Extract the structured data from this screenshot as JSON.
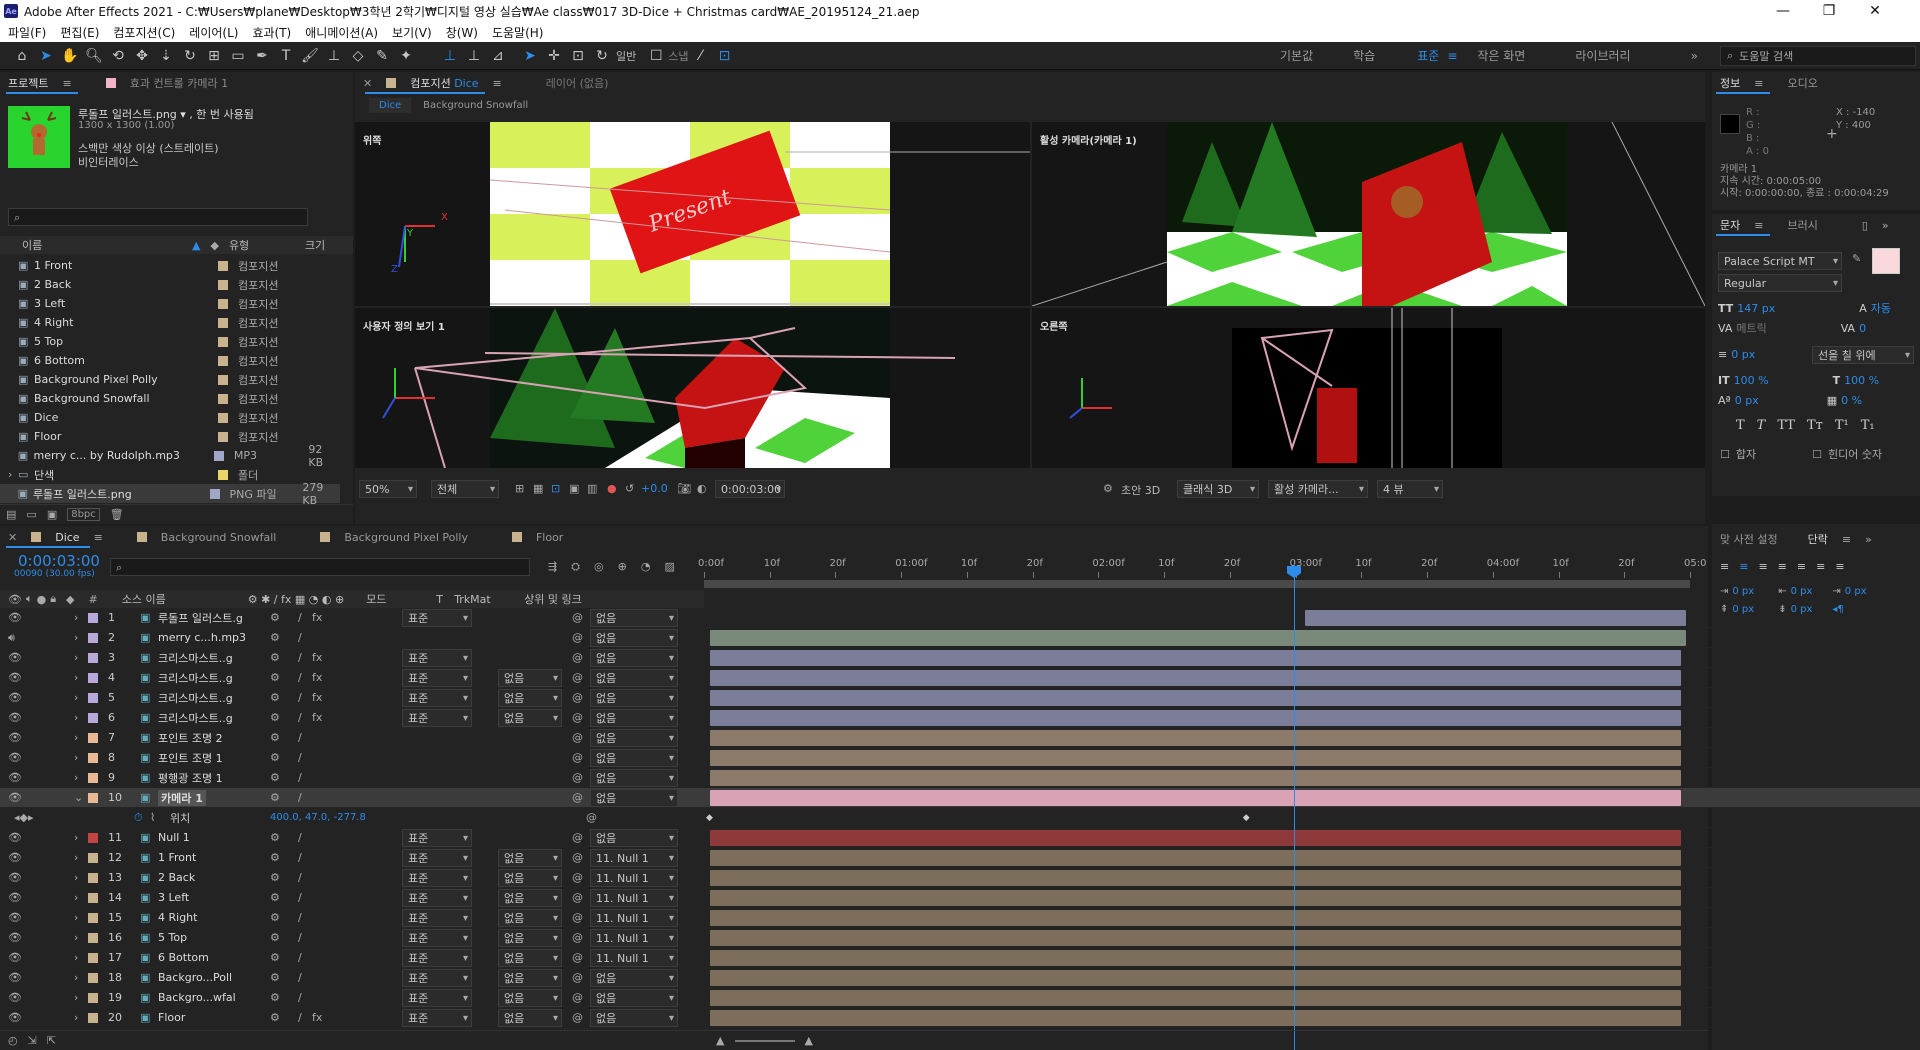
{
  "window": {
    "title": "Adobe After Effects 2021 - C:₩Users₩plane₩Desktop₩3학년 2학기₩디지털 영상 실습₩Ae class₩017 3D-Dice + Christmas card₩AE_20195124_21.aep",
    "minimize": "—",
    "maximize": "❐",
    "close": "✕"
  },
  "menu": [
    "파일(F)",
    "편집(E)",
    "컴포지션(C)",
    "레이어(L)",
    "효과(T)",
    "애니메이션(A)",
    "보기(V)",
    "창(W)",
    "도움말(H)"
  ],
  "toolbar": {
    "snap_label": "스냅",
    "orbit_label": "일반",
    "workspaces": [
      "기본값",
      "학습",
      "표준",
      "작은 화면",
      "라이브러리"
    ],
    "active_workspace": "표준",
    "help_search": "도움말 검색",
    "expand": "»"
  },
  "project": {
    "tab": "프로젝트",
    "effects_tab": "효과 컨트롤 카메라 1",
    "asset_name": "루돌프 일러스트.png ▾ , 한 번 사용됨",
    "asset_size": "1300 x 1300 (1.00)",
    "asset_alpha": "스백만 색상 이상 (스트레이트)",
    "asset_interlace": "비인터레이스",
    "col_name": "이름",
    "col_type": "유형",
    "col_size": "크기",
    "items": [
      {
        "name": "1 Front",
        "type": "컴포지션",
        "size": "",
        "color": "#c8b38e"
      },
      {
        "name": "2 Back",
        "type": "컴포지션",
        "size": "",
        "color": "#c8b38e"
      },
      {
        "name": "3 Left",
        "type": "컴포지션",
        "size": "",
        "color": "#c8b38e"
      },
      {
        "name": "4 Right",
        "type": "컴포지션",
        "size": "",
        "color": "#c8b38e"
      },
      {
        "name": "5 Top",
        "type": "컴포지션",
        "size": "",
        "color": "#c8b38e"
      },
      {
        "name": "6 Bottom",
        "type": "컴포지션",
        "size": "",
        "color": "#c8b38e"
      },
      {
        "name": "Background Pixel  Polly",
        "type": "컴포지션",
        "size": "",
        "color": "#c8b38e"
      },
      {
        "name": "Background Snowfall",
        "type": "컴포지션",
        "size": "",
        "color": "#c8b38e"
      },
      {
        "name": "Dice",
        "type": "컴포지션",
        "size": "",
        "color": "#c8b38e"
      },
      {
        "name": "Floor",
        "type": "컴포지션",
        "size": "",
        "color": "#c8b38e"
      },
      {
        "name": "merry c... by Rudolph.mp3",
        "type": "MP3",
        "size": "92 KB",
        "color": "#9fa6c8"
      },
      {
        "name": "단색",
        "type": "폴더",
        "size": "",
        "color": "#e8d56a"
      },
      {
        "name": "루돌프 일러스트.png",
        "type": "PNG 파일",
        "size": "279 KB",
        "color": "#9fa6c8"
      }
    ],
    "bpc": "8bpc"
  },
  "composition": {
    "tab": "컴포지션",
    "tab_comp": "Dice",
    "layer_tab": "레이어 (없음)",
    "breadcrumb": [
      "Dice",
      "Background Snowfall"
    ],
    "views": [
      "위쪽",
      "활성 카메라(카메라 1)",
      "사용자 정의 보기 1",
      "오른쪽"
    ],
    "zoom": "50%",
    "resolution": "전체",
    "timecode": "0:00:03:00",
    "exposure": "+0.0",
    "draft3d": "초안 3D",
    "renderer": "클래식 3D",
    "camera": "활성 카메라...",
    "views_count": "4 뷰"
  },
  "info": {
    "tab": "정보",
    "audio_tab": "오디오",
    "r": "R :",
    "g": "G :",
    "b": "B :",
    "a": "A :  0",
    "x": "X : -140",
    "y": "Y : 400",
    "camera_name": "카메라 1",
    "duration": "지속 시간: 0:00:05:00",
    "start_end": "시작: 0:00:00:00, 종료 : 0:00:04:29"
  },
  "character": {
    "tab": "문자",
    "brush_tab": "브러시",
    "font": "Palace Script MT",
    "style": "Regular",
    "size": "147 px",
    "leading": "자동",
    "kerning": "메트릭",
    "tracking": "0",
    "stroke": "0 px",
    "stroke_mode": "선을 칠 위에",
    "vscale": "100 %",
    "hscale": "100 %",
    "baseline": "0 px",
    "tsume": "0 %",
    "ligatures": "합자",
    "hindi": "힌디어 숫자"
  },
  "paragraph": {
    "tab": "맞 사전 설정",
    "tab2": "단락",
    "indent_left": "0 px",
    "indent_right": "0 px",
    "space_before": "0 px",
    "space_after": "0 px",
    "first_line": "0 px"
  },
  "timeline": {
    "tabs": [
      "Dice",
      "Background Snowfall",
      "Background Pixel  Polly",
      "Floor"
    ],
    "current_time": "0:00:03:00",
    "frame_info": "00090 (30.00 fps)",
    "col_source": "소스 이름",
    "col_mode": "모드",
    "col_t": "T",
    "col_trkmat": "TrkMat",
    "col_parent": "상위 및 링크",
    "ruler": [
      "0:00f",
      "10f",
      "20f",
      "01:00f",
      "10f",
      "20f",
      "02:00f",
      "10f",
      "20f",
      "03:00f",
      "10f",
      "20f",
      "04:00f",
      "10f",
      "20f",
      "05:0"
    ],
    "layers": [
      {
        "num": "1",
        "name": "루돌프 일러스트.g",
        "label": "#b7a8d9",
        "mode": "표준",
        "trkmat": "",
        "parent": "없음",
        "bar": "#7b7d99",
        "bar_start": 0.61,
        "bar_end": 1.0,
        "fx": true
      },
      {
        "num": "2",
        "name": "merry c...h.mp3",
        "label": "#b7a8d9",
        "mode": "",
        "trkmat": "",
        "parent": "없음",
        "bar": "#7a8a7a",
        "bar_start": 0.0,
        "bar_end": 1.0,
        "fx": false
      },
      {
        "num": "3",
        "name": "크리스마스트..g",
        "label": "#b7a8d9",
        "mode": "표준",
        "trkmat": "",
        "parent": "없음",
        "bar": "#7b7d99",
        "bar_start": 0.0,
        "bar_end": 0.995,
        "fx": true
      },
      {
        "num": "4",
        "name": "크리스마스트..g",
        "label": "#b7a8d9",
        "mode": "표준",
        "trkmat": "없음",
        "parent": "없음",
        "bar": "#7b7d99",
        "bar_start": 0.0,
        "bar_end": 0.995,
        "fx": true
      },
      {
        "num": "5",
        "name": "크리스마스트..g",
        "label": "#b7a8d9",
        "mode": "표준",
        "trkmat": "없음",
        "parent": "없음",
        "bar": "#7b7d99",
        "bar_start": 0.0,
        "bar_end": 0.995,
        "fx": true
      },
      {
        "num": "6",
        "name": "크리스마스트..g",
        "label": "#b7a8d9",
        "mode": "표준",
        "trkmat": "없음",
        "parent": "없음",
        "bar": "#7b7d99",
        "bar_start": 0.0,
        "bar_end": 0.995,
        "fx": true
      },
      {
        "num": "7",
        "name": "포인트 조명 2",
        "label": "#e8b995",
        "mode": "",
        "trkmat": "",
        "parent": "없음",
        "bar": "#8c7a6b",
        "bar_start": 0.0,
        "bar_end": 0.995,
        "fx": false
      },
      {
        "num": "8",
        "name": "포인트 조명 1",
        "label": "#e8b995",
        "mode": "",
        "trkmat": "",
        "parent": "없음",
        "bar": "#8c7a6b",
        "bar_start": 0.0,
        "bar_end": 0.995,
        "fx": false
      },
      {
        "num": "9",
        "name": "평행광 조명 1",
        "label": "#e8b995",
        "mode": "",
        "trkmat": "",
        "parent": "없음",
        "bar": "#8c7a6b",
        "bar_start": 0.0,
        "bar_end": 0.995,
        "fx": false
      },
      {
        "num": "10",
        "name": "카메라 1",
        "label": "#e8b995",
        "mode": "",
        "trkmat": "",
        "parent": "없음",
        "bar": "#d9a3b5",
        "bar_start": 0.0,
        "bar_end": 0.995,
        "fx": false,
        "selected": true
      },
      {
        "num": "",
        "name": "위치",
        "prop": true,
        "value": "400.0, 47.0, -277.8"
      },
      {
        "num": "11",
        "name": "Null 1",
        "label": "#c44444",
        "mode": "표준",
        "trkmat": "",
        "parent": "없음",
        "bar": "#8e3a3a",
        "bar_start": 0.0,
        "bar_end": 0.995,
        "fx": false
      },
      {
        "num": "12",
        "name": "1 Front",
        "label": "#c8b38e",
        "mode": "표준",
        "trkmat": "없음",
        "parent": "11. Null 1",
        "bar": "#7d6e5b",
        "bar_start": 0.0,
        "bar_end": 0.995,
        "fx": false
      },
      {
        "num": "13",
        "name": "2 Back",
        "label": "#c8b38e",
        "mode": "표준",
        "trkmat": "없음",
        "parent": "11. Null 1",
        "bar": "#7d6e5b",
        "bar_start": 0.0,
        "bar_end": 0.995,
        "fx": false
      },
      {
        "num": "14",
        "name": "3 Left",
        "label": "#c8b38e",
        "mode": "표준",
        "trkmat": "없음",
        "parent": "11. Null 1",
        "bar": "#7d6e5b",
        "bar_start": 0.0,
        "bar_end": 0.995,
        "fx": false
      },
      {
        "num": "15",
        "name": "4 Right",
        "label": "#c8b38e",
        "mode": "표준",
        "trkmat": "없음",
        "parent": "11. Null 1",
        "bar": "#7d6e5b",
        "bar_start": 0.0,
        "bar_end": 0.995,
        "fx": false
      },
      {
        "num": "16",
        "name": "5 Top",
        "label": "#c8b38e",
        "mode": "표준",
        "trkmat": "없음",
        "parent": "11. Null 1",
        "bar": "#7d6e5b",
        "bar_start": 0.0,
        "bar_end": 0.995,
        "fx": false
      },
      {
        "num": "17",
        "name": "6 Bottom",
        "label": "#c8b38e",
        "mode": "표준",
        "trkmat": "없음",
        "parent": "11. Null 1",
        "bar": "#7d6e5b",
        "bar_start": 0.0,
        "bar_end": 0.995,
        "fx": false
      },
      {
        "num": "18",
        "name": "Backgro...Poll",
        "label": "#c8b38e",
        "mode": "표준",
        "trkmat": "없음",
        "parent": "없음",
        "bar": "#7d6e5b",
        "bar_start": 0.0,
        "bar_end": 0.995,
        "fx": false
      },
      {
        "num": "19",
        "name": "Backgro...wfal",
        "label": "#c8b38e",
        "mode": "표준",
        "trkmat": "없음",
        "parent": "없음",
        "bar": "#7d6e5b",
        "bar_start": 0.0,
        "bar_end": 0.995,
        "fx": false
      },
      {
        "num": "20",
        "name": "Floor",
        "label": "#c8b38e",
        "mode": "표준",
        "trkmat": "없음",
        "parent": "없음",
        "bar": "#7d6e5b",
        "bar_start": 0.0,
        "bar_end": 0.995,
        "fx": true
      }
    ],
    "playhead_fraction": 0.6,
    "keyframe_fractions": [
      0.0,
      0.55
    ]
  },
  "colors": {
    "accent": "#2d8ceb",
    "panel": "#232323",
    "bg": "#1d1d1d"
  }
}
